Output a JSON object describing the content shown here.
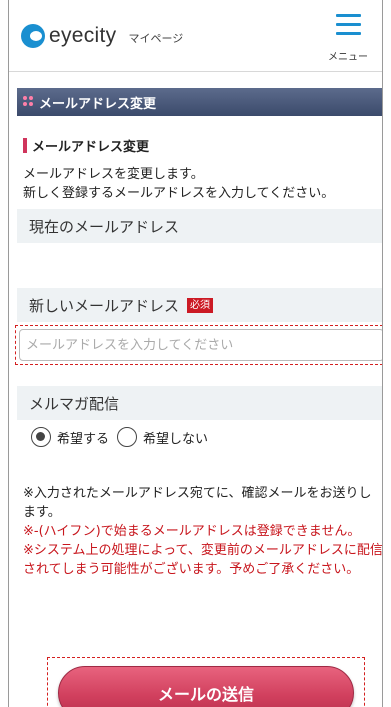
{
  "header": {
    "brand": "eyecity",
    "mypage_label": "マイページ",
    "menu_label": "メニュー"
  },
  "section": {
    "title": "メールアドレス変更",
    "subheading": "メールアドレス変更",
    "intro_line1": "メールアドレスを変更します。",
    "intro_line2": "新しく登録するメールアドレスを入力してください。"
  },
  "current_email": {
    "label": "現在のメールアドレス",
    "value": ""
  },
  "new_email": {
    "label": "新しいメールアドレス",
    "required_badge": "必須",
    "placeholder": "メールアドレスを入力してください",
    "value": ""
  },
  "newsletter": {
    "label": "メルマガ配信",
    "options": [
      {
        "label": "希望する",
        "selected": true
      },
      {
        "label": "希望しない",
        "selected": false
      }
    ]
  },
  "notes": [
    {
      "text": "※入力されたメールアドレス宛てに、確認メールをお送りします。",
      "color": "#222222"
    },
    {
      "text": "※-(ハイフン)で始まるメールアドレスは登録できません。",
      "color": "#c8161d"
    },
    {
      "text": "※システム上の処理によって、変更前のメールアドレスに配信されてしまう可能性がございます。予めご了承ください。",
      "color": "#c8161d"
    }
  ],
  "submit": {
    "label": "メールの送信"
  },
  "colors": {
    "accent_blue": "#1a8fd0",
    "accent_pink": "#d0355c",
    "title_bar": "#3b4a6b"
  }
}
